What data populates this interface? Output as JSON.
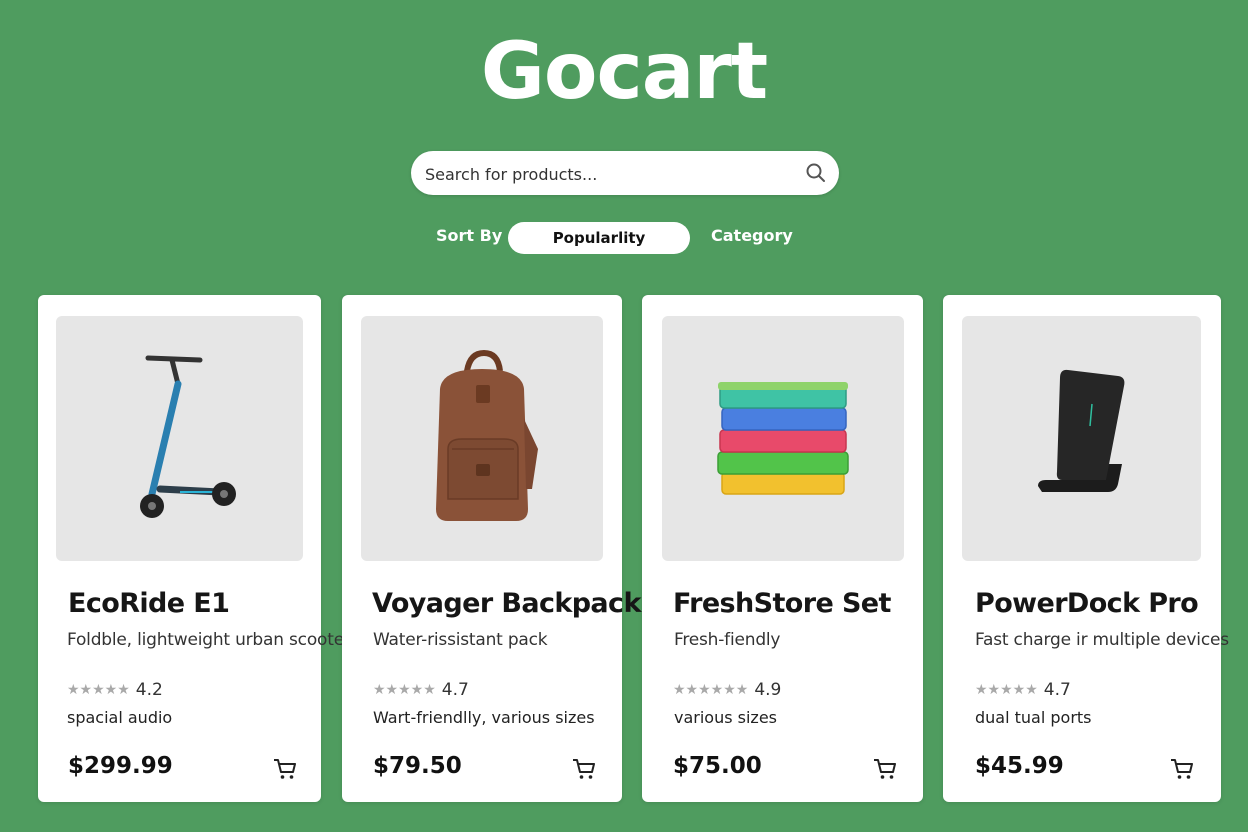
{
  "app": {
    "title": "Gocart"
  },
  "search": {
    "placeholder": "Search for products..."
  },
  "sort": {
    "label": "Sort By",
    "selected": "Popularlity",
    "category_label": "Category"
  },
  "products": [
    {
      "name": "EcoRide E1",
      "description": "Foldble, lightweight urban scooter",
      "stars": "★★★★★",
      "rating": "4.2",
      "feature": "spacial audio",
      "price": "$299.99",
      "image_icon": "scooter-icon"
    },
    {
      "name": "Voyager Backpack",
      "description": "Water-rissistant pack",
      "stars": "★★★★★",
      "rating": "4.7",
      "feature": "Wart-friendlly, various sizes",
      "price": "$79.50",
      "image_icon": "backpack-icon"
    },
    {
      "name": "FreshStore Set",
      "description": "Fresh-fiendly",
      "stars": "★★★★★★",
      "rating": "4.9",
      "feature": "various sizes",
      "price": "$75.00",
      "image_icon": "containers-icon"
    },
    {
      "name": "PowerDock Pro",
      "description": "Fast charge ir multiple devices",
      "stars": "★★★★★",
      "rating": "4.7",
      "feature": "dual tual ports",
      "price": "$45.99",
      "image_icon": "charger-icon"
    }
  ],
  "colors": {
    "background": "#4f9c5f",
    "card": "#ffffff",
    "thumb": "#e6e6e6"
  }
}
